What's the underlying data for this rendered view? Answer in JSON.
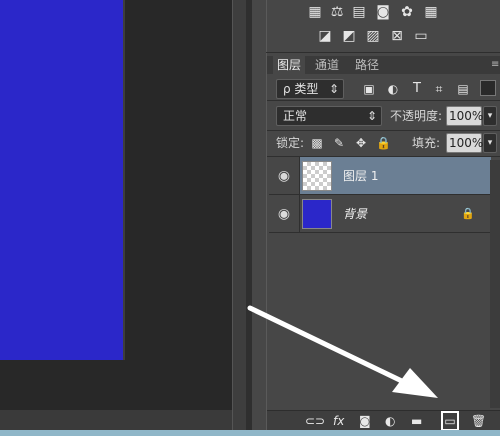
{
  "panel": {
    "tabs": [
      {
        "label": "图层",
        "active": true
      },
      {
        "label": "通道",
        "active": false
      },
      {
        "label": "路径",
        "active": false
      }
    ],
    "filter": {
      "value": "ρ 类型",
      "chevron": "⇕"
    },
    "filter_icons": [
      "image-filter-icon",
      "adjustment-filter-icon",
      "T",
      "shape-filter-icon",
      "smart-object-filter-icon"
    ],
    "blend_mode": "正常",
    "opacity_label": "不透明度:",
    "opacity_value": "100%",
    "lock_label": "锁定:",
    "fill_label": "填充:",
    "fill_value": "100%",
    "layers": [
      {
        "name": "图层 1",
        "selected": true,
        "visible": true
      },
      {
        "name": "背景",
        "selected": false,
        "visible": true,
        "locked": true
      }
    ],
    "bottom_bar": [
      "link-icon",
      "fx",
      "mask-icon",
      "adjustment-icon",
      "folder-icon",
      "new-layer-icon",
      "trash-icon"
    ]
  },
  "colors": {
    "canvas_fill": "#2b27c9",
    "selected_layer": "#6b7f94",
    "panel_bg": "#474747",
    "arrow": "#ffffff",
    "highlight_box": "#ffffff"
  }
}
